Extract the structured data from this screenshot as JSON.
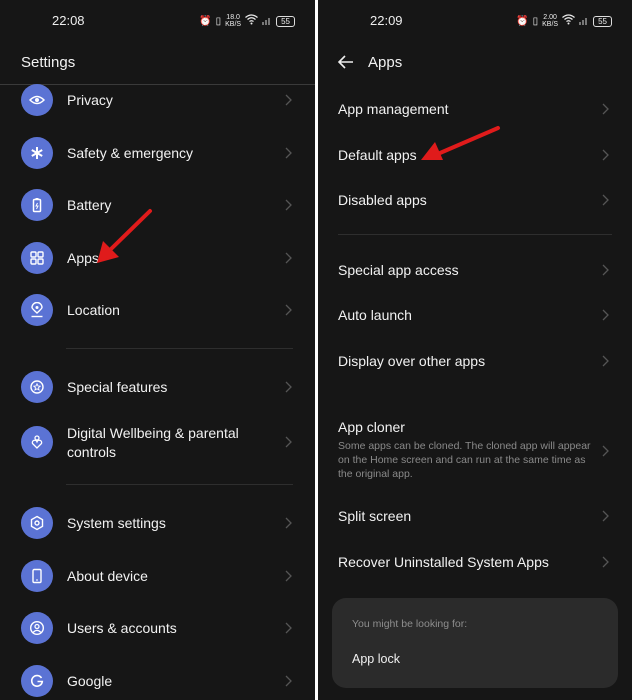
{
  "left": {
    "status": {
      "time": "22:08",
      "speed_value": "18.0",
      "speed_unit": "KB/S",
      "battery": "55"
    },
    "title": "Settings",
    "items": [
      {
        "label": "Privacy",
        "icon": "privacy-eye-icon"
      },
      {
        "label": "Safety & emergency",
        "icon": "asterisk-icon"
      },
      {
        "label": "Battery",
        "icon": "battery-icon"
      },
      {
        "label": "Apps",
        "icon": "apps-grid-icon"
      },
      {
        "label": "Location",
        "icon": "location-pin-icon"
      },
      {
        "label": "Special features",
        "icon": "star-circle-icon"
      },
      {
        "label": "Digital Wellbeing & parental controls",
        "icon": "wellbeing-heart-icon"
      },
      {
        "label": "System settings",
        "icon": "hexagon-gear-icon"
      },
      {
        "label": "About device",
        "icon": "phone-icon"
      },
      {
        "label": "Users & accounts",
        "icon": "user-circle-icon"
      },
      {
        "label": "Google",
        "icon": "google-g-icon"
      }
    ]
  },
  "right": {
    "status": {
      "time": "22:09",
      "speed_value": "2.00",
      "speed_unit": "KB/S",
      "battery": "55"
    },
    "title": "Apps",
    "items": [
      {
        "label": "App management"
      },
      {
        "label": "Default apps"
      },
      {
        "label": "Disabled apps"
      },
      {
        "label": "Special app access"
      },
      {
        "label": "Auto launch"
      },
      {
        "label": "Display over other apps"
      },
      {
        "label": "App cloner",
        "description": "Some apps can be cloned. The cloned app will appear on the Home screen and can run at the same time as the original app."
      },
      {
        "label": "Split screen"
      },
      {
        "label": "Recover Uninstalled System Apps"
      }
    ],
    "suggestion": {
      "hint": "You might be looking for:",
      "link": "App lock"
    }
  },
  "colors": {
    "accent": "#5b73d4",
    "background": "#161616",
    "annotation_arrow": "#e01b1b"
  }
}
